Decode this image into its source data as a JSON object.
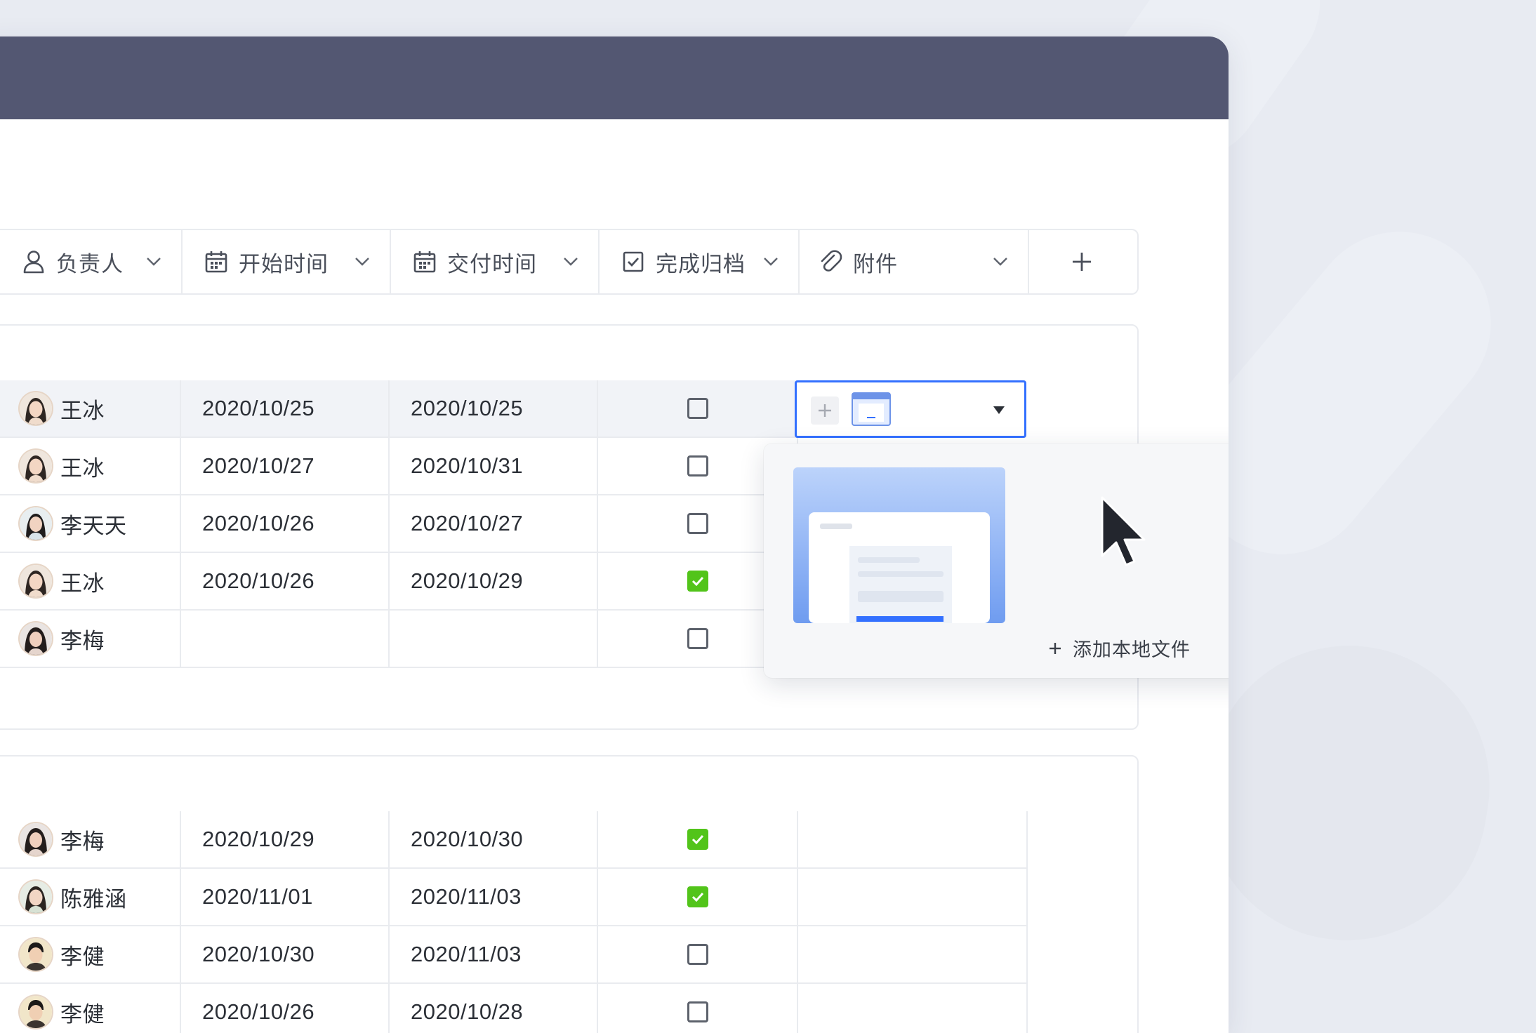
{
  "columns": [
    {
      "label": "负责人",
      "icon": "person-icon"
    },
    {
      "label": "开始时间",
      "icon": "calendar-icon"
    },
    {
      "label": "交付时间",
      "icon": "calendar-icon"
    },
    {
      "label": "完成归档",
      "icon": "checkbox-icon"
    },
    {
      "label": "附件",
      "icon": "paperclip-icon"
    }
  ],
  "add_column_label": "+",
  "group1": {
    "rows": [
      {
        "owner": "王冰",
        "start": "2020/10/25",
        "end": "2020/10/25",
        "done": false
      },
      {
        "owner": "王冰",
        "start": "2020/10/27",
        "end": "2020/10/31",
        "done": false
      },
      {
        "owner": "李天天",
        "start": "2020/10/26",
        "end": "2020/10/27",
        "done": false
      },
      {
        "owner": "王冰",
        "start": "2020/10/26",
        "end": "2020/10/29",
        "done": true
      },
      {
        "owner": "李梅",
        "start": "",
        "end": "",
        "done": false
      }
    ]
  },
  "group2": {
    "rows": [
      {
        "owner": "李梅",
        "start": "2020/10/29",
        "end": "2020/10/30",
        "done": true
      },
      {
        "owner": "陈雅涵",
        "start": "2020/11/01",
        "end": "2020/11/03",
        "done": true
      },
      {
        "owner": "李健",
        "start": "2020/10/30",
        "end": "2020/11/03",
        "done": false
      },
      {
        "owner": "李健",
        "start": "2020/10/26",
        "end": "2020/10/28",
        "done": false
      }
    ]
  },
  "attachment_dropdown": {
    "add_local_label": "添加本地文件",
    "add_symbol": "+"
  },
  "colors": {
    "titlebar": "#535772",
    "accent": "#3370ff",
    "checked": "#52c41a"
  }
}
